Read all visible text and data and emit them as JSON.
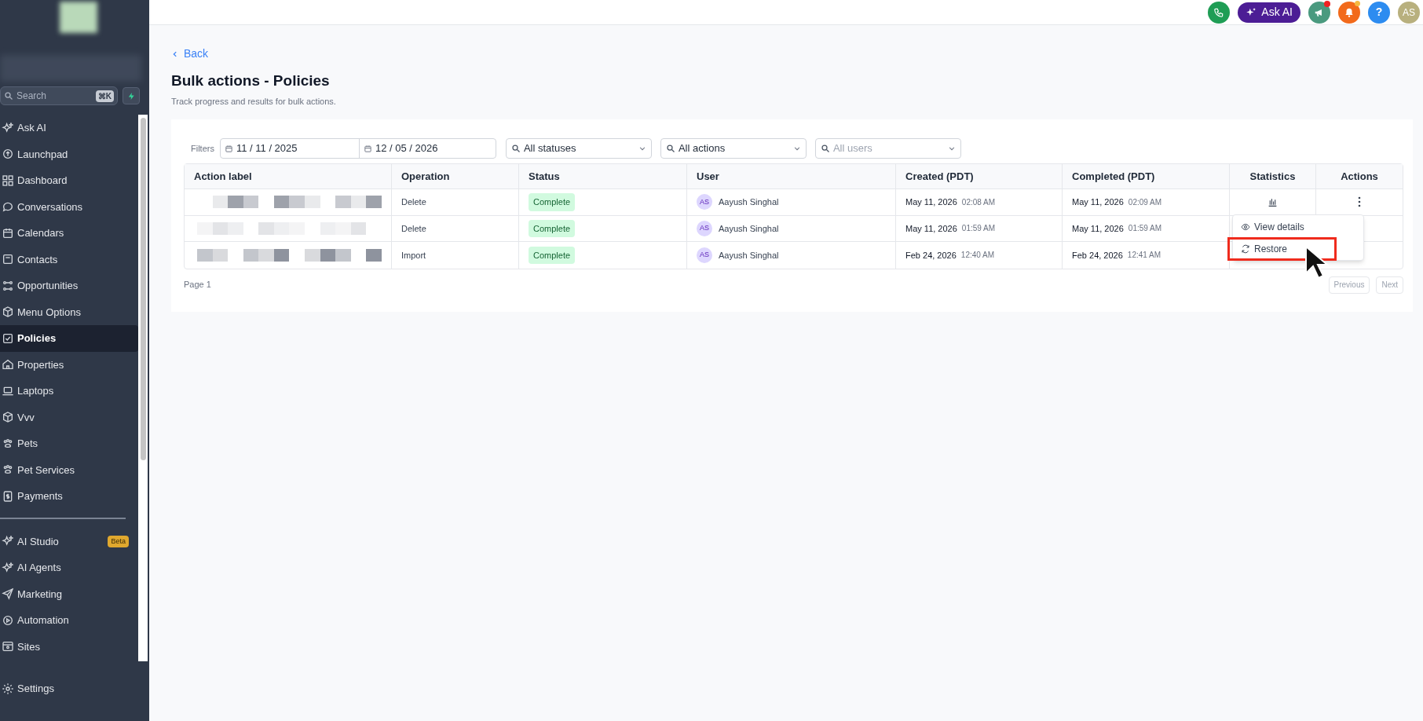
{
  "header": {
    "ask_ai": "Ask AI",
    "avatar": "AS",
    "megaphone_badge": true,
    "bell_badge": true,
    "help": "?"
  },
  "sidebar": {
    "search": {
      "placeholder": "Search",
      "shortcut": "⌘K"
    },
    "primary_items": [
      {
        "label": "Ask AI",
        "selected": false
      },
      {
        "label": "Launchpad",
        "selected": false
      },
      {
        "label": "Dashboard",
        "selected": false
      },
      {
        "label": "Conversations",
        "selected": false
      },
      {
        "label": "Calendars",
        "selected": false
      },
      {
        "label": "Contacts",
        "selected": false
      },
      {
        "label": "Opportunities",
        "selected": false
      },
      {
        "label": "Menu Options",
        "selected": false
      },
      {
        "label": "Policies",
        "selected": true
      },
      {
        "label": "Properties",
        "selected": false
      },
      {
        "label": "Laptops",
        "selected": false
      },
      {
        "label": "Vvv",
        "selected": false
      },
      {
        "label": "Pets",
        "selected": false
      },
      {
        "label": "Pet Services",
        "selected": false
      },
      {
        "label": "Payments",
        "selected": false
      }
    ],
    "secondary_items": [
      {
        "label": "AI Studio",
        "selected": false,
        "badge": "Beta"
      },
      {
        "label": "AI Agents",
        "selected": false
      },
      {
        "label": "Marketing",
        "selected": false
      },
      {
        "label": "Automation",
        "selected": false
      },
      {
        "label": "Sites",
        "selected": false
      }
    ],
    "footer_item": {
      "label": "Settings",
      "selected": false
    }
  },
  "page": {
    "back": "Back",
    "title": "Bulk actions - Policies",
    "subtitle": "Track progress and results for bulk actions."
  },
  "filters": {
    "label": "Filters",
    "date_from": "11 / 11 / 2025",
    "date_to": "12 / 05 / 2026",
    "status": "All statuses",
    "action": "All actions",
    "user_placeholder": "All users"
  },
  "table": {
    "columns": [
      "Action label",
      "Operation",
      "Status",
      "User",
      "Created (PDT)",
      "Completed (PDT)",
      "Statistics",
      "Actions"
    ],
    "rows": [
      {
        "operation": "Delete",
        "status": "Complete",
        "user": {
          "initials": "AS",
          "name": "Aayush Singhal"
        },
        "created": {
          "date": "May 11, 2026",
          "time": "02:08 AM"
        },
        "completed": {
          "date": "May 11, 2026",
          "time": "02:09 AM"
        }
      },
      {
        "operation": "Delete",
        "status": "Complete",
        "user": {
          "initials": "AS",
          "name": "Aayush Singhal"
        },
        "created": {
          "date": "May 11, 2026",
          "time": "01:59 AM"
        },
        "completed": {
          "date": "May 11, 2026",
          "time": "01:59 AM"
        }
      },
      {
        "operation": "Import",
        "status": "Complete",
        "user": {
          "initials": "AS",
          "name": "Aayush Singhal"
        },
        "created": {
          "date": "Feb 24, 2026",
          "time": "12:40 AM"
        },
        "completed": {
          "date": "Feb 24, 2026",
          "time": "12:41 AM"
        }
      }
    ]
  },
  "row_menu": {
    "items": [
      {
        "label": "View details",
        "kind": "view",
        "highlighted": false
      },
      {
        "label": "Restore",
        "kind": "restore",
        "highlighted": true
      }
    ]
  },
  "pagination": {
    "page": "Page 1",
    "previous": {
      "label": "Previous",
      "disabled": true
    },
    "next": {
      "label": "Next",
      "disabled": true
    }
  }
}
